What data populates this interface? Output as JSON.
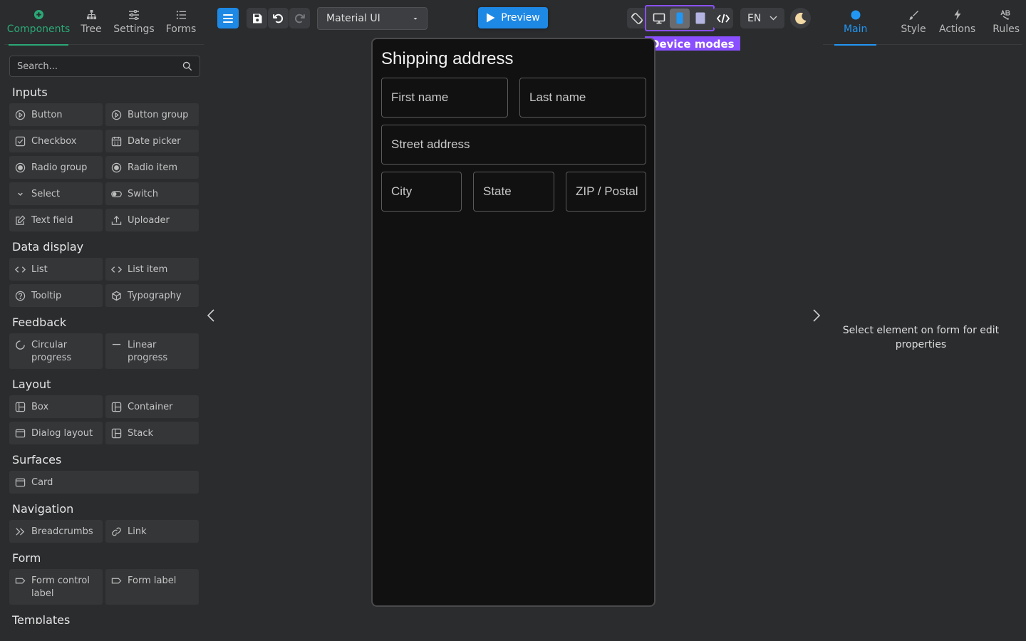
{
  "left_tabs": [
    {
      "label": "Components",
      "active": true,
      "icon": "plus-circle-icon"
    },
    {
      "label": "Tree",
      "active": false,
      "icon": "tree-icon"
    },
    {
      "label": "Settings",
      "active": false,
      "icon": "sliders-icon"
    },
    {
      "label": "Forms",
      "active": false,
      "icon": "list-icon"
    }
  ],
  "search": {
    "placeholder": "Search..."
  },
  "palette": {
    "inputs": {
      "title": "Inputs",
      "items": [
        "Button",
        "Button group",
        "Checkbox",
        "Date picker",
        "Radio group",
        "Radio item",
        "Select",
        "Switch",
        "Text field",
        "Uploader"
      ]
    },
    "data_display": {
      "title": "Data display",
      "items": [
        "List",
        "List item",
        "Tooltip",
        "Typography"
      ]
    },
    "feedback": {
      "title": "Feedback",
      "items": [
        "Circular progress",
        "Linear progress"
      ]
    },
    "layout": {
      "title": "Layout",
      "items": [
        "Box",
        "Container",
        "Dialog layout",
        "Stack"
      ]
    },
    "surfaces": {
      "title": "Surfaces",
      "items": [
        "Card"
      ]
    },
    "navigation": {
      "title": "Navigation",
      "items": [
        "Breadcrumbs",
        "Link"
      ]
    },
    "form": {
      "title": "Form",
      "items": [
        "Form control label",
        "Form label"
      ]
    },
    "templates": {
      "title": "Templates"
    }
  },
  "toolbar": {
    "theme_select": "Material UI",
    "preview_label": "Preview",
    "device_modes_label": "Device modes",
    "active_device": "mobile",
    "language": "EN"
  },
  "form": {
    "title": "Shipping address",
    "fields": {
      "first_name": "First name",
      "last_name": "Last name",
      "street": "Street address",
      "city": "City",
      "state": "State",
      "zip": "ZIP / Postal"
    }
  },
  "right_tabs": [
    {
      "label": "Main",
      "active": true,
      "icon": "dot-icon"
    },
    {
      "label": "Style",
      "active": false,
      "icon": "brush-icon"
    },
    {
      "label": "Actions",
      "active": false,
      "icon": "lightning-icon"
    },
    {
      "label": "Rules",
      "active": false,
      "icon": "ab-icon"
    }
  ],
  "right_hint": "Select element on form for edit properties",
  "colors": {
    "accent_green": "#2aa876",
    "accent_blue": "#1e88e5",
    "device_modes_highlight": "#8a4fff",
    "background": "#2b2c2e",
    "canvas": "#111111"
  }
}
